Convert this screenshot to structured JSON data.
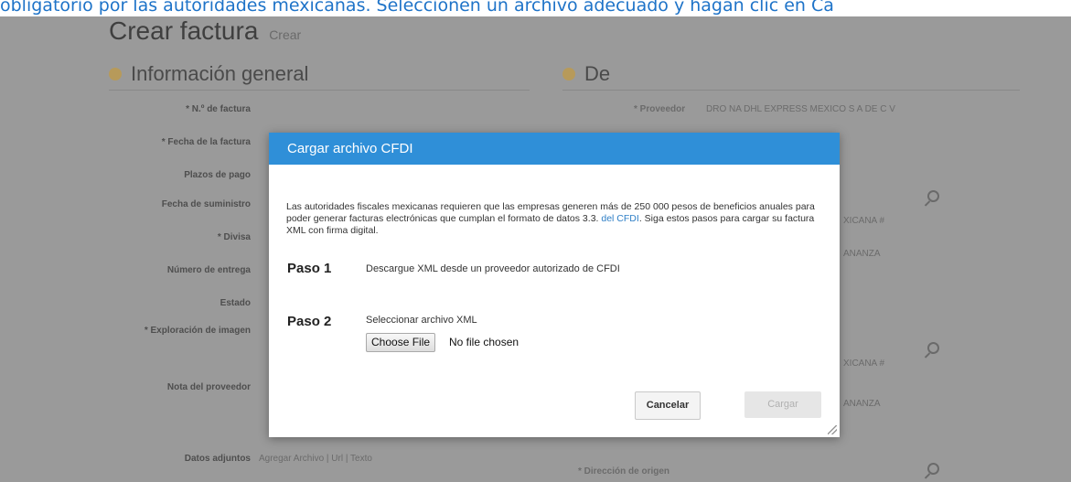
{
  "top_text": "obligatorio por las autoridades mexicanas. Seleccionen un archivo adecuado y hagan clic en Ca",
  "page": {
    "title": "Crear factura",
    "title_sub": "Crear",
    "section_left": "Información general",
    "section_right": "De",
    "labels": [
      "* N.º de factura",
      "* Fecha de la factura",
      "Plazos de pago",
      "Fecha de suministro",
      "* Divisa",
      "Número de entrega",
      "Estado",
      "* Exploración de imagen",
      "Nota del proveedor",
      "Datos adjuntos"
    ],
    "bg_texts": {
      "proveedor_label": "* Proveedor",
      "proveedor_value": "DRO NA DHL EXPRESS MEXICO S A DE C V",
      "right_1": "XICANA #",
      "right_2": "ANANZA",
      "right_3": "XICANA #",
      "right_4": "ANANZA",
      "adjuntos_value": "Agregar Archivo | Url | Texto",
      "bottom_label": "* Dirección de origen"
    }
  },
  "modal": {
    "title": "Cargar archivo CFDI",
    "desc_before_link": "Las autoridades fiscales mexicanas requieren que las empresas generen más de 250 000 pesos de beneficios anuales para poder generar facturas electrónicas que cumplan el formato de datos 3.3.",
    "desc_link": "del CFDI",
    "desc_after_link": ". Siga estos pasos para cargar su factura XML con firma digital.",
    "step1_label": "Paso 1",
    "step1_text": "Descargue XML desde un proveedor autorizado de CFDI",
    "step2_label": "Paso 2",
    "step2_text": "Seleccionar archivo XML",
    "file_button": "Choose File",
    "file_status": "No file chosen",
    "cancel_button": "Cancelar",
    "load_button": "Cargar"
  },
  "colors": {
    "modal_header": "#2f8fd8",
    "link": "#2f7fc6",
    "top_text": "#1e73c8",
    "overlay": "#9a9a9a"
  }
}
